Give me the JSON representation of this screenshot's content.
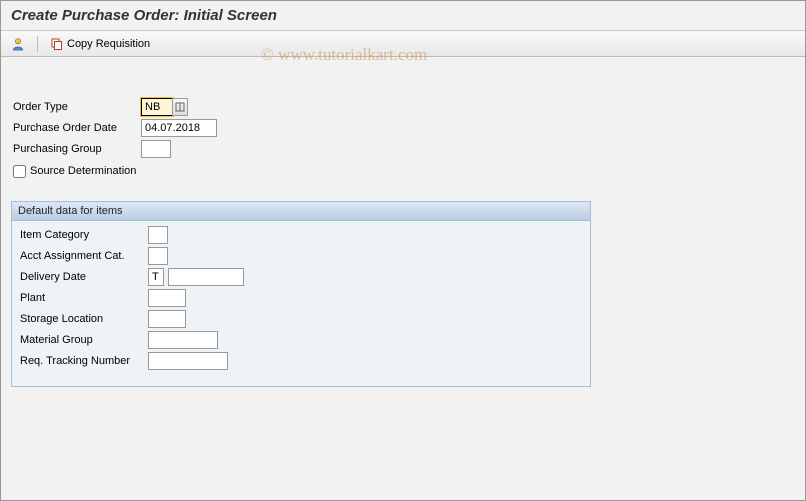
{
  "title": "Create Purchase Order: Initial Screen",
  "toolbar": {
    "copy_req_label": "Copy Requisition"
  },
  "header": {
    "order_type": {
      "label": "Order Type",
      "value": "NB"
    },
    "po_date": {
      "label": "Purchase Order Date",
      "value": "04.07.2018"
    },
    "purch_group": {
      "label": "Purchasing Group",
      "value": ""
    },
    "source_det": {
      "label": "Source Determination",
      "checked": false
    }
  },
  "defaults": {
    "title": "Default data for items",
    "item_cat": {
      "label": "Item Category",
      "value": ""
    },
    "acct_assign": {
      "label": "Acct Assignment Cat.",
      "value": ""
    },
    "deliv_date": {
      "label": "Delivery Date",
      "type_value": "T",
      "value": ""
    },
    "plant": {
      "label": "Plant",
      "value": ""
    },
    "storage_loc": {
      "label": "Storage Location",
      "value": ""
    },
    "mat_group": {
      "label": "Material Group",
      "value": ""
    },
    "req_track": {
      "label": "Req. Tracking Number",
      "value": ""
    }
  },
  "watermark": "© www.tutorialkart.com"
}
